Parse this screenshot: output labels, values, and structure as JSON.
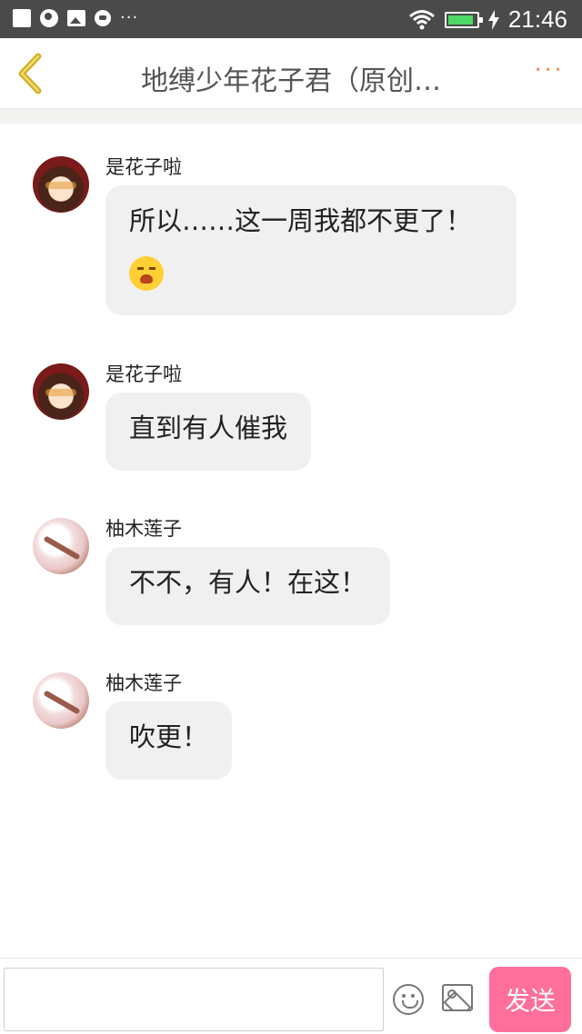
{
  "status_bar": {
    "time": "21:46",
    "battery_level": 0.9,
    "left_icons": [
      "square-notification-icon",
      "globe-icon",
      "image-icon",
      "chat-icon",
      "more-notifications-icon"
    ],
    "right_icons": [
      "wifi-icon",
      "battery-icon",
      "charging-icon"
    ]
  },
  "header": {
    "title": "地缚少年花子君（原创…",
    "back_icon": "chevron-left-icon",
    "more_icon": "more-dots-icon",
    "accent_color": "#f0956a",
    "back_color": "#d4b12a"
  },
  "messages": [
    {
      "sender": "是花子啦",
      "text": "所以……这一周我都不更了！",
      "emoji": "crying-face-emoji",
      "avatar": "red-haired-girl-avatar"
    },
    {
      "sender": "是花子啦",
      "text": "直到有人催我",
      "avatar": "red-haired-girl-avatar"
    },
    {
      "sender": "柚木莲子",
      "text": "不不，有人！在这！",
      "avatar": "cherry-blossom-avatar"
    },
    {
      "sender": "柚木莲子",
      "text": "吹更！",
      "avatar": "cherry-blossom-avatar"
    }
  ],
  "input_bar": {
    "placeholder": "",
    "emoji_icon": "smiley-icon",
    "image_icon": "picture-icon",
    "send_label": "发送",
    "send_color": "#ff6f9c"
  }
}
